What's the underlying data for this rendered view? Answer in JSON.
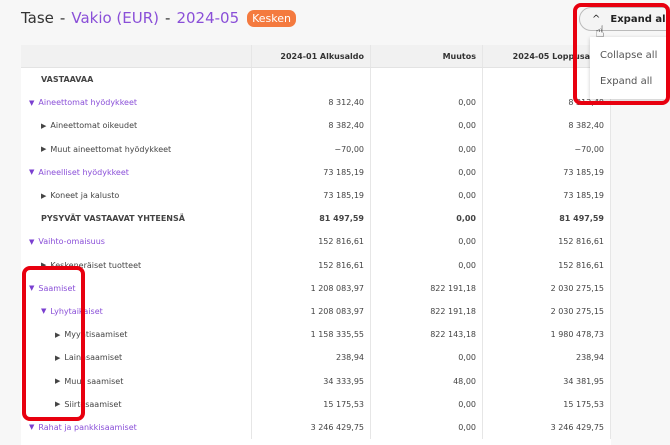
{
  "header": {
    "title": "Tase",
    "sep": "-",
    "ledger": "Vakio (EUR)",
    "period": "2024-05",
    "status": "Kesken"
  },
  "toolbar": {
    "expand_label": "Expand all",
    "menu": [
      "Collapse all",
      "Expand all"
    ]
  },
  "colors": {
    "accent": "#8a4fd8",
    "badge": "#f47a3f",
    "highlight": "#e8000f"
  },
  "table": {
    "columns": [
      "",
      "2024-01 Alkusaldo",
      "Muutos",
      "2024-05 Loppusaldo"
    ],
    "rows": [
      {
        "label": "VASTAAVAA",
        "level": 0,
        "type": "heading",
        "values": [
          "",
          "",
          ""
        ]
      },
      {
        "label": "Aineettomat hyödykkeet",
        "level": 0,
        "type": "group",
        "values": [
          "8 312,40",
          "0,00",
          "8 312,40"
        ]
      },
      {
        "label": "Aineettomat oikeudet",
        "level": 1,
        "type": "leaf",
        "values": [
          "8 382,40",
          "0,00",
          "8 382,40"
        ]
      },
      {
        "label": "Muut aineettomat hyödykkeet",
        "level": 1,
        "type": "leaf",
        "values": [
          "−70,00",
          "0,00",
          "−70,00"
        ]
      },
      {
        "label": "Aineelliset hyödykkeet",
        "level": 0,
        "type": "group",
        "values": [
          "73 185,19",
          "0,00",
          "73 185,19"
        ]
      },
      {
        "label": "Koneet ja kalusto",
        "level": 1,
        "type": "leaf",
        "values": [
          "73 185,19",
          "0,00",
          "73 185,19"
        ]
      },
      {
        "label": "PYSYVÄT VASTAAVAT YHTEENSÄ",
        "level": 0,
        "type": "total",
        "values": [
          "81 497,59",
          "0,00",
          "81 497,59"
        ]
      },
      {
        "label": "Vaihto-omaisuus",
        "level": 0,
        "type": "group",
        "values": [
          "152 816,61",
          "0,00",
          "152 816,61"
        ]
      },
      {
        "label": "Keskeneräiset tuotteet",
        "level": 1,
        "type": "leaf",
        "values": [
          "152 816,61",
          "0,00",
          "152 816,61"
        ]
      },
      {
        "label": "Saamiset",
        "level": 0,
        "type": "group",
        "values": [
          "1 208 083,97",
          "822 191,18",
          "2 030 275,15"
        ]
      },
      {
        "label": "Lyhytaikaiset",
        "level": 1,
        "type": "group",
        "values": [
          "1 208 083,97",
          "822 191,18",
          "2 030 275,15"
        ]
      },
      {
        "label": "Myyntisaamiset",
        "level": 2,
        "type": "leaf",
        "values": [
          "1 158 335,55",
          "822 143,18",
          "1 980 478,73"
        ]
      },
      {
        "label": "Lainasaamiset",
        "level": 2,
        "type": "leaf",
        "values": [
          "238,94",
          "0,00",
          "238,94"
        ]
      },
      {
        "label": "Muut saamiset",
        "level": 2,
        "type": "leaf",
        "values": [
          "34 333,95",
          "48,00",
          "34 381,95"
        ]
      },
      {
        "label": "Siirtosaamiset",
        "level": 2,
        "type": "leaf",
        "values": [
          "15 175,53",
          "0,00",
          "15 175,53"
        ]
      },
      {
        "label": "Rahat ja pankkisaamiset",
        "level": 0,
        "type": "group",
        "values": [
          "3 246 429,75",
          "0,00",
          "3 246 429,75"
        ]
      }
    ]
  }
}
